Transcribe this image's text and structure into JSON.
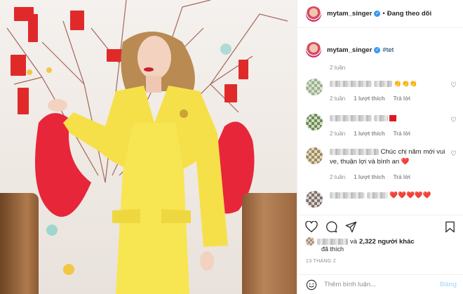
{
  "post": {
    "username": "mytam_singer",
    "follow_status": "Đang theo dõi",
    "follow_separator": "•"
  },
  "caption": {
    "username": "mytam_singer",
    "text": "#tet",
    "time": "2 tuần"
  },
  "comments": [
    {
      "text_prefix_blurred": true,
      "text": "",
      "emoji": "👏👏👏",
      "time": "2 tuần",
      "likes": "1 lượt thích",
      "reply": "Trả lời"
    },
    {
      "text_prefix_blurred": true,
      "text": "",
      "emoji": "",
      "time": "2 tuần",
      "likes": "1 lượt thích",
      "reply": "Trả lời"
    },
    {
      "text_prefix_blurred": true,
      "text": "Chúc chị năm mới vui ve, thuận lợi và bình an",
      "emoji": "❤️",
      "time": "2 tuần",
      "likes": "1 lượt thích",
      "reply": "Trả lời"
    },
    {
      "text_prefix_blurred": true,
      "text": "",
      "emoji": "❤️❤️❤️❤️❤️",
      "time": "",
      "likes": "",
      "reply": ""
    }
  ],
  "likes": {
    "prefix": "và",
    "count": "2,322 người khác",
    "suffix": "đã thích"
  },
  "date": "13 THÁNG 2",
  "composer": {
    "placeholder": "Thêm bình luận...",
    "post_label": "Đăng"
  },
  "icons": {
    "like": "heart-icon",
    "comment": "comment-icon",
    "share": "send-icon",
    "save": "bookmark-icon",
    "emoji": "smiley-icon",
    "verified": "verified-badge-icon"
  },
  "colors": {
    "verified": "#3897f0",
    "link": "#00376b",
    "muted": "#8e8e8e",
    "post_disabled": "#b2dffc",
    "heart_red": "#e0191f"
  }
}
